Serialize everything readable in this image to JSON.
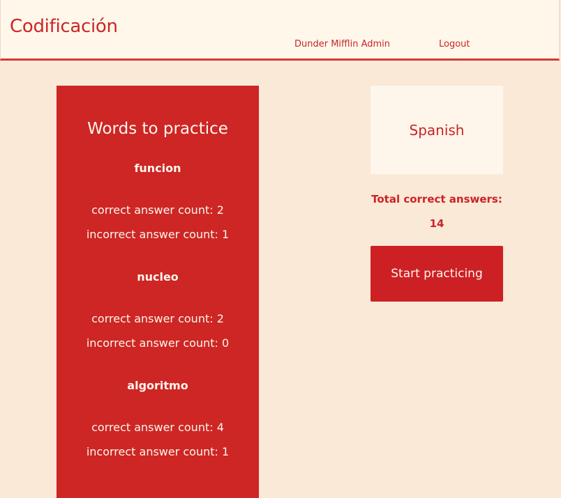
{
  "header": {
    "logo": "Codificación",
    "user_link": "Dunder Mifflin Admin",
    "logout_link": "Logout"
  },
  "words_panel": {
    "title": "Words to practice",
    "words": [
      {
        "word": "funcion",
        "correct": "correct answer count: 2",
        "incorrect": "incorrect answer count: 1"
      },
      {
        "word": "nucleo",
        "correct": "correct answer count: 2",
        "incorrect": "incorrect answer count: 0"
      },
      {
        "word": "algoritmo",
        "correct": "correct answer count: 4",
        "incorrect": "incorrect answer count: 1"
      }
    ]
  },
  "language_card": {
    "language": "Spanish"
  },
  "totals": {
    "label": "Total correct answers:",
    "value": "14"
  },
  "actions": {
    "start_label": "Start practicing"
  },
  "colors": {
    "brand_red": "#cd2624",
    "page_bg": "#fae9d7",
    "card_bg": "#fef6ea"
  }
}
